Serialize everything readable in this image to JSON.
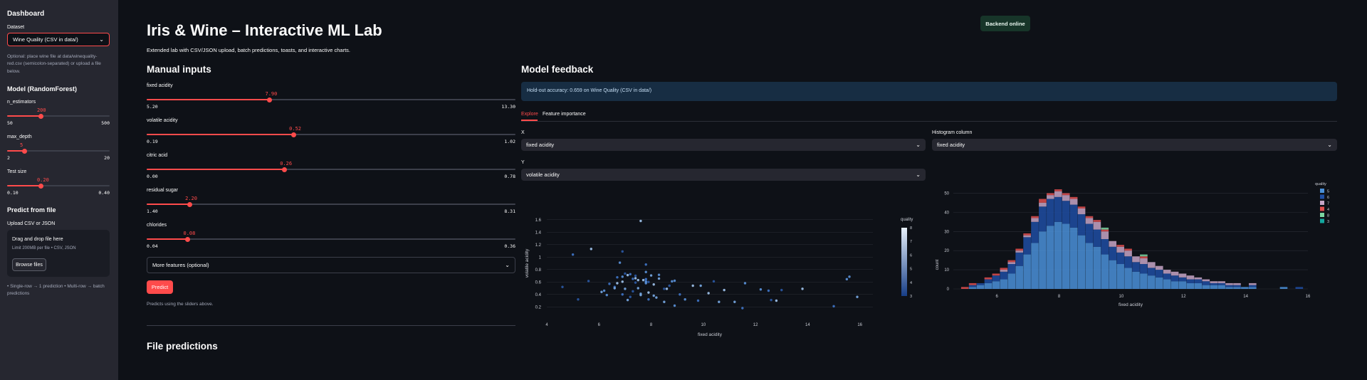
{
  "sidebar": {
    "title": "Dashboard",
    "dataset_label": "Dataset",
    "dataset_value": "Wine Quality (CSV in data/)",
    "dataset_note": "Optional: place wine file at data/winequality-red.csv (semicolon-separated) or upload a file below.",
    "model_title": "Model (RandomForest)",
    "sliders": [
      {
        "label": "n_estimators",
        "value": "200",
        "min": "50",
        "max": "500",
        "fraction": 0.333
      },
      {
        "label": "max_depth",
        "value": "5",
        "min": "2",
        "max": "20",
        "fraction": 0.167
      },
      {
        "label": "Test size",
        "value": "0.20",
        "min": "0.10",
        "max": "0.40",
        "fraction": 0.333
      }
    ],
    "predict_title": "Predict from file",
    "upload_label": "Upload CSV or JSON",
    "drop_title": "Drag and drop file here",
    "drop_limit": "Limit 200MB per file • CSV, JSON",
    "browse_label": "Browse files",
    "footnote": "• Single-row → 1 prediction • Multi-row → batch predictions"
  },
  "header": {
    "status_badge": "Backend online",
    "title": "Iris & Wine – Interactive ML Lab",
    "subtitle": "Extended lab with CSV/JSON upload, batch predictions, toasts, and interactive charts."
  },
  "manual": {
    "title": "Manual inputs",
    "sliders": [
      {
        "label": "fixed acidity",
        "value": "7.90",
        "min": "5.20",
        "max": "13.30",
        "fraction": 0.333
      },
      {
        "label": "volatile acidity",
        "value": "0.52",
        "min": "0.19",
        "max": "1.02",
        "fraction": 0.398
      },
      {
        "label": "citric acid",
        "value": "0.26",
        "min": "0.00",
        "max": "0.78",
        "fraction": 0.373
      },
      {
        "label": "residual sugar",
        "value": "2.20",
        "min": "1.40",
        "max": "8.31",
        "fraction": 0.116
      },
      {
        "label": "chlorides",
        "value": "0.08",
        "min": "0.04",
        "max": "0.36",
        "fraction": 0.111
      }
    ],
    "more_features": "More features (optional)",
    "predict_button": "Predict",
    "predict_caption": "Predicts using the sliders above."
  },
  "feedback": {
    "title": "Model feedback",
    "accuracy": "Hold-out accuracy: 0.659 on Wine Quality (CSV in data/)",
    "tabs": [
      "Explore",
      "Feature importance"
    ],
    "x_label": "X",
    "x_value": "fixed acidity",
    "y_label": "Y",
    "y_value": "volatile acidity",
    "hist_label": "Histogram column",
    "hist_value": "fixed acidity"
  },
  "file_predictions_title": "File predictions",
  "colors": {
    "accent": "#ff4b4b",
    "background": "#0e1117",
    "sidebar": "#262730"
  },
  "chart_data": [
    {
      "type": "scatter",
      "xlabel": "fixed acidity",
      "ylabel": "volatile acidity",
      "xticks": [
        "4",
        "6",
        "8",
        "10",
        "12",
        "14",
        "16"
      ],
      "yticks": [
        "0.2",
        "0.4",
        "0.6",
        "0.8",
        "1",
        "1.2",
        "1.4",
        "1.6"
      ],
      "xlim": [
        4,
        16.5
      ],
      "ylim": [
        0.1,
        1.7
      ],
      "colorbar": {
        "title": "quality",
        "ticks": [
          "3",
          "4",
          "5",
          "6",
          "7",
          "8"
        ]
      },
      "points": [
        [
          7.4,
          0.7
        ],
        [
          7.8,
          0.88
        ],
        [
          7.8,
          0.76
        ],
        [
          11.2,
          0.28
        ],
        [
          7.4,
          0.66
        ],
        [
          7.9,
          0.6
        ],
        [
          7.3,
          0.65
        ],
        [
          7.8,
          0.58
        ],
        [
          7.5,
          0.5
        ],
        [
          6.7,
          0.58
        ],
        [
          5.6,
          0.615
        ],
        [
          7.8,
          0.61
        ],
        [
          8.9,
          0.62
        ],
        [
          8.5,
          0.28
        ],
        [
          8.1,
          0.56
        ],
        [
          7.4,
          0.59
        ],
        [
          7.9,
          0.32
        ],
        [
          8.9,
          0.22
        ],
        [
          7.6,
          0.39
        ],
        [
          7.9,
          0.43
        ],
        [
          8.5,
          0.49
        ],
        [
          6.9,
          0.4
        ],
        [
          6.3,
          0.39
        ],
        [
          7.6,
          0.41
        ],
        [
          7.1,
          0.71
        ],
        [
          7.8,
          0.645
        ],
        [
          6.7,
          0.675
        ],
        [
          6.9,
          0.685
        ],
        [
          8.3,
          0.655
        ],
        [
          6.9,
          0.605
        ],
        [
          5.2,
          0.32
        ],
        [
          7.8,
          0.645
        ],
        [
          7.8,
          0.6
        ],
        [
          8.1,
          0.38
        ],
        [
          5.7,
          1.13
        ],
        [
          7.3,
          0.45
        ],
        [
          6.6,
          0.52
        ],
        [
          8.8,
          0.61
        ],
        [
          6.6,
          0.5
        ],
        [
          10.2,
          0.42
        ],
        [
          7.0,
          0.735
        ],
        [
          7.2,
          0.725
        ],
        [
          9.3,
          0.32
        ],
        [
          8.0,
          0.705
        ],
        [
          7.7,
          0.63
        ],
        [
          8.7,
          0.54
        ],
        [
          6.4,
          0.57
        ],
        [
          6.8,
          0.91
        ],
        [
          10.6,
          0.28
        ],
        [
          12.8,
          0.3
        ],
        [
          12.6,
          0.31
        ],
        [
          15.0,
          0.21
        ],
        [
          15.6,
          0.685
        ],
        [
          15.9,
          0.36
        ],
        [
          13.8,
          0.49
        ],
        [
          13.0,
          0.47
        ],
        [
          12.5,
          0.46
        ],
        [
          11.6,
          0.58
        ],
        [
          9.9,
          0.54
        ],
        [
          10.8,
          0.47
        ],
        [
          4.6,
          0.52
        ],
        [
          5.0,
          1.04
        ],
        [
          15.5,
          0.645
        ],
        [
          6.1,
          0.44
        ],
        [
          7.6,
          1.58
        ],
        [
          6.9,
          1.09
        ],
        [
          9.1,
          0.4
        ],
        [
          8.3,
          0.715
        ],
        [
          7.0,
          0.49
        ],
        [
          7.5,
          0.63
        ],
        [
          10.4,
          0.61
        ],
        [
          11.5,
          0.18
        ],
        [
          12.2,
          0.48
        ],
        [
          8.2,
          0.35
        ],
        [
          9.6,
          0.54
        ],
        [
          7.2,
          0.36
        ],
        [
          9.8,
          0.3
        ],
        [
          6.2,
          0.46
        ],
        [
          7.1,
          0.31
        ],
        [
          8.6,
          0.49
        ]
      ]
    },
    {
      "type": "bar",
      "stacked": true,
      "xlabel": "fixed acidity",
      "ylabel": "count",
      "xticks": [
        "6",
        "8",
        "10",
        "12",
        "14",
        "16"
      ],
      "yticks": [
        "0",
        "10",
        "20",
        "30",
        "40",
        "50"
      ],
      "xlim": [
        4.6,
        16.0
      ],
      "ylim": [
        0,
        55
      ],
      "legend_title": "quality",
      "legend_position": "right",
      "bin_start": 4.6,
      "bin_width": 0.25,
      "series": [
        {
          "name": "5",
          "color": "#4a90d9",
          "values": [
            0,
            0,
            1,
            2,
            3,
            4,
            5,
            8,
            12,
            18,
            24,
            30,
            33,
            35,
            34,
            32,
            28,
            24,
            22,
            18,
            15,
            13,
            11,
            9,
            8,
            7,
            6,
            5,
            4,
            4,
            3,
            3,
            2,
            2,
            2,
            1,
            1,
            1,
            1,
            0,
            0,
            0,
            1,
            0,
            0,
            0
          ]
        },
        {
          "name": "6",
          "color": "#1f4ea3",
          "values": [
            0,
            0,
            1,
            1,
            2,
            3,
            4,
            5,
            7,
            9,
            11,
            13,
            14,
            13,
            12,
            12,
            11,
            10,
            9,
            8,
            7,
            6,
            6,
            5,
            5,
            4,
            4,
            3,
            3,
            2,
            2,
            2,
            2,
            1,
            1,
            1,
            1,
            0,
            1,
            0,
            0,
            0,
            0,
            0,
            1,
            0
          ]
        },
        {
          "name": "7",
          "color": "#c7a6c7",
          "values": [
            0,
            0,
            0,
            0,
            0,
            0,
            1,
            1,
            1,
            1,
            2,
            2,
            2,
            3,
            3,
            3,
            3,
            3,
            4,
            4,
            3,
            3,
            3,
            3,
            3,
            3,
            2,
            2,
            2,
            2,
            2,
            1,
            1,
            1,
            1,
            1,
            1,
            0,
            1,
            0,
            0,
            0,
            0,
            0,
            0,
            0
          ]
        },
        {
          "name": "4",
          "color": "#e04f4f",
          "values": [
            0,
            1,
            1,
            0,
            1,
            1,
            1,
            1,
            1,
            1,
            1,
            2,
            1,
            1,
            1,
            1,
            1,
            1,
            1,
            1,
            0,
            1,
            1,
            0,
            1,
            0,
            0,
            0,
            0,
            0,
            0,
            0,
            0,
            0,
            0,
            0,
            0,
            0,
            0,
            0,
            0,
            0,
            0,
            0,
            0,
            0
          ]
        },
        {
          "name": "8",
          "color": "#7bd6a2",
          "values": [
            0,
            0,
            0,
            0,
            0,
            0,
            0,
            0,
            0,
            0,
            0,
            0,
            0,
            0,
            0,
            0,
            0,
            0,
            0,
            1,
            0,
            0,
            0,
            0,
            1,
            0,
            0,
            0,
            0,
            0,
            0,
            0,
            0,
            0,
            0,
            0,
            0,
            0,
            0,
            0,
            0,
            0,
            0,
            0,
            0,
            0
          ]
        },
        {
          "name": "3",
          "color": "#14a69e",
          "values": [
            0,
            0,
            0,
            0,
            0,
            0,
            0,
            0,
            0,
            0,
            0,
            0,
            0,
            0,
            0,
            0,
            0,
            0,
            0,
            0,
            0,
            0,
            0,
            0,
            0,
            0,
            0,
            0,
            0,
            0,
            0,
            0,
            0,
            0,
            0,
            0,
            0,
            0,
            0,
            0,
            0,
            0,
            0,
            0,
            0,
            0
          ]
        }
      ]
    }
  ]
}
